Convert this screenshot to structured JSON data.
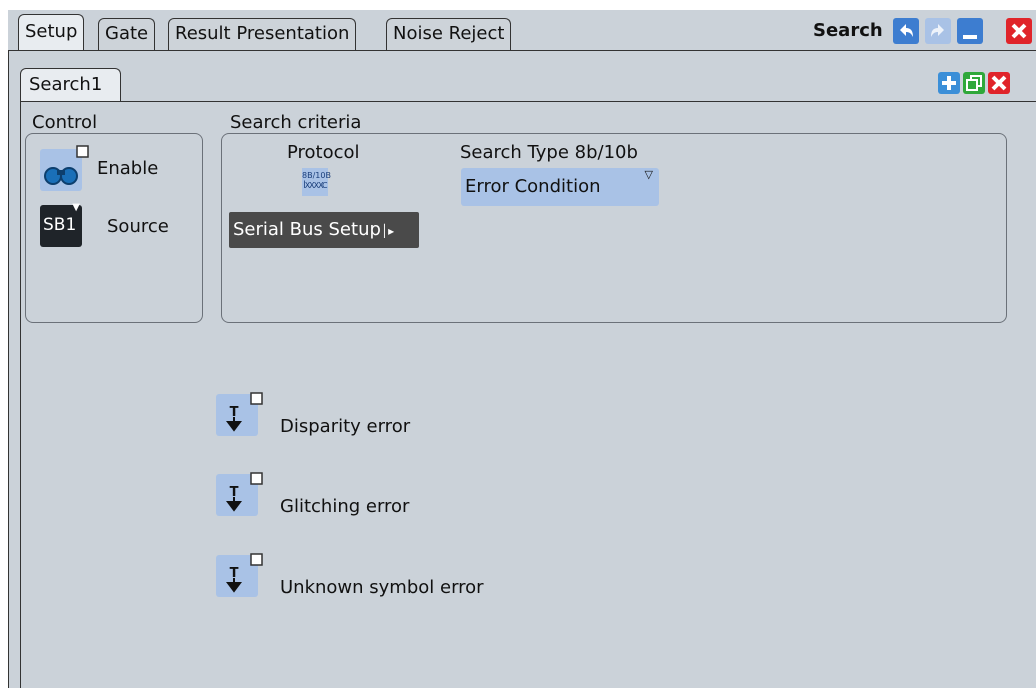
{
  "dialog": {
    "title": "Search",
    "tabs": [
      {
        "label": "Setup",
        "active": true
      },
      {
        "label": "Gate",
        "active": false
      },
      {
        "label": "Result Presentation",
        "active": false
      },
      {
        "label": "Noise Reject",
        "active": false
      }
    ]
  },
  "search_tab": {
    "label": "Search1"
  },
  "control": {
    "heading": "Control",
    "enable_label": "Enable",
    "source_label": "Source",
    "source_value": "SB1"
  },
  "criteria": {
    "heading": "Search criteria",
    "protocol_label": "Protocol",
    "protocol_icon_text": "8B/10B",
    "serial_bus_button": "Serial Bus Setup",
    "search_type_label": "Search Type 8b/10b",
    "search_type_value": "Error Condition"
  },
  "errors": [
    {
      "label": "Disparity error",
      "checked": false
    },
    {
      "label": "Glitching error",
      "checked": false
    },
    {
      "label": "Unknown symbol error",
      "checked": false
    }
  ],
  "colors": {
    "panel_bg": "#cbd2d9",
    "button_blue": "#a9c2e6",
    "close_red": "#e0242a",
    "add_blue": "#3b8fd8",
    "copy_green": "#2fa83a"
  }
}
